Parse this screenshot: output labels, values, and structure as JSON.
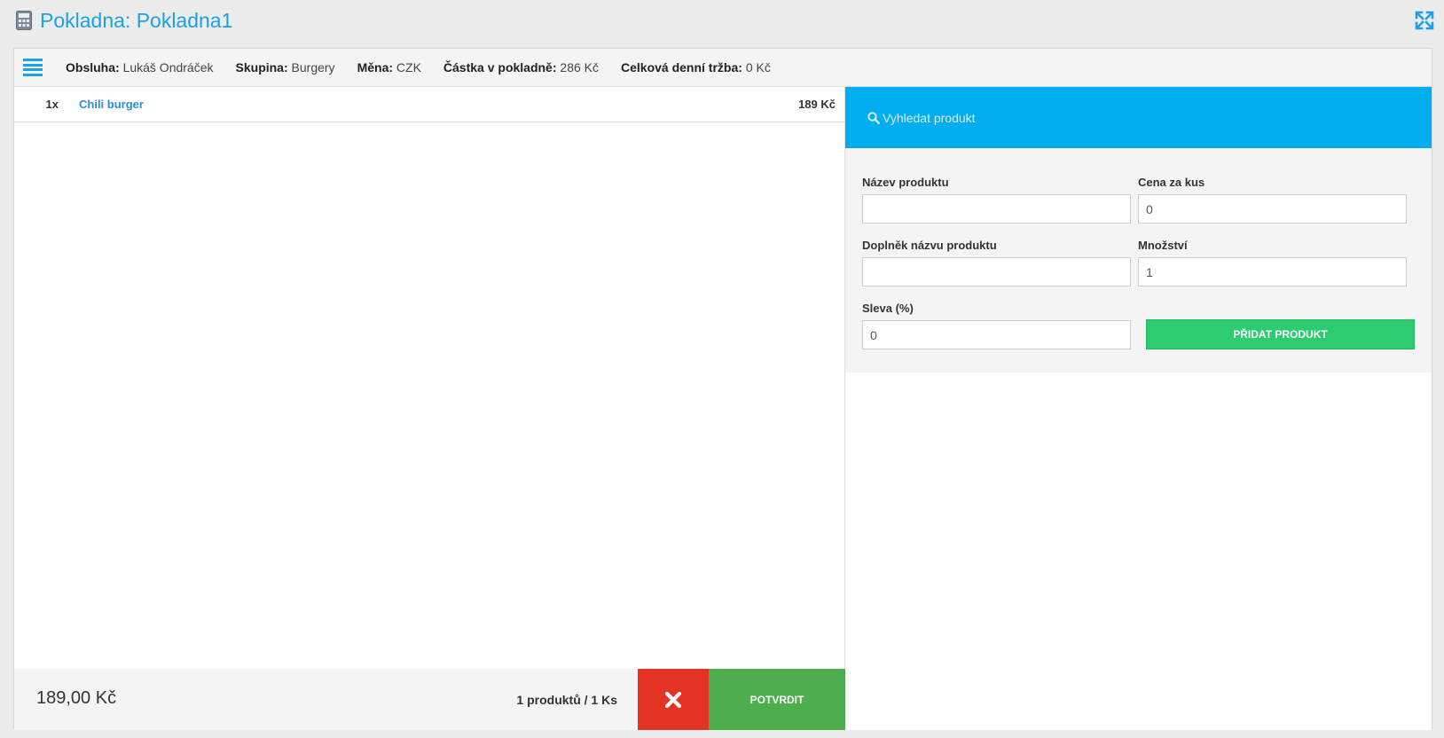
{
  "window": {
    "title": "Pokladna: Pokladna1"
  },
  "info": {
    "operator_label": "Obsluha:",
    "operator_value": "Lukáš Ondráček",
    "group_label": "Skupina:",
    "group_value": "Burgery",
    "currency_label": "Měna:",
    "currency_value": "CZK",
    "register_amount_label": "Částka v pokladně:",
    "register_amount_value": "286 Kč",
    "daily_revenue_label": "Celková denní tržba:",
    "daily_revenue_value": "0 Kč"
  },
  "cart": {
    "items": [
      {
        "qty": "1x",
        "name": "Chili burger",
        "price": "189 Kč"
      }
    ],
    "total": "189,00 Kč",
    "count": "1 produktů / 1 Ks",
    "confirm_label": "POTVRDIT"
  },
  "search": {
    "placeholder": "Vyhledat produkt"
  },
  "form": {
    "name_label": "Název produktu",
    "name_value": "",
    "price_label": "Cena za kus",
    "price_value": "0",
    "suffix_label": "Doplněk názvu produktu",
    "suffix_value": "",
    "quantity_label": "Množství",
    "quantity_value": "1",
    "discount_label": "Sleva (%)",
    "discount_value": "0",
    "add_label": "PŘIDAT PRODUKT"
  },
  "colors": {
    "accent": "#1da0e6",
    "search_bg": "#00adee",
    "cancel": "#e43325",
    "confirm": "#4cae4c",
    "add": "#2ecc71"
  },
  "icons": {
    "title": "calculator-icon",
    "fullscreen": "expand-icon",
    "menu": "hamburger-icon",
    "search": "search-icon",
    "cancel": "close-icon"
  }
}
